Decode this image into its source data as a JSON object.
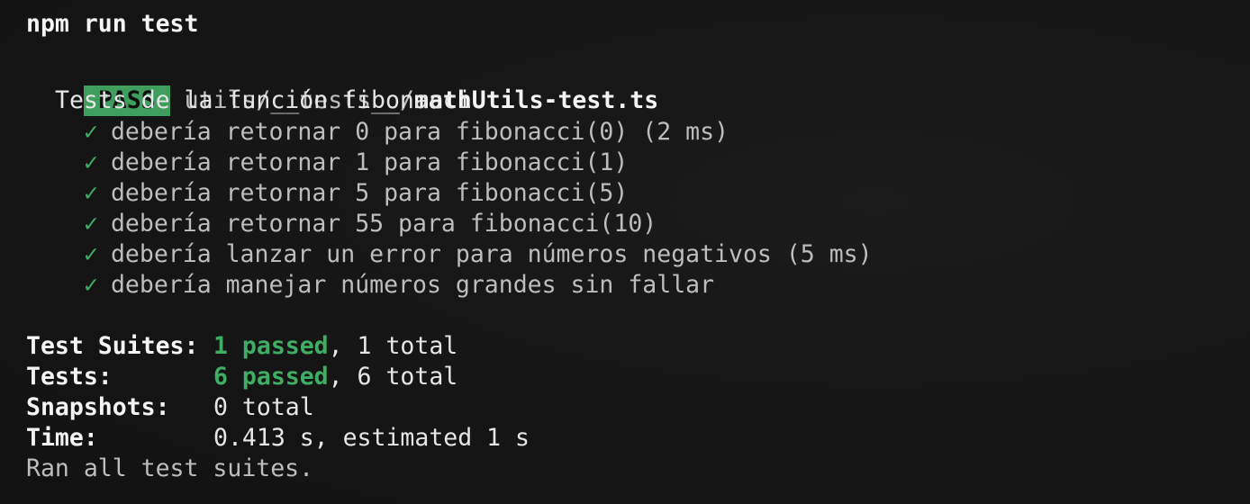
{
  "command": "npm run test",
  "result": {
    "badge": "PASS",
    "path_dir": "utils/__tests__/",
    "path_file": "mathUtils-test.ts"
  },
  "describe": "Tests de la función fibonacci",
  "check_glyph": "✓",
  "tests": [
    {
      "name": "debería retornar 0 para fibonacci(0)",
      "time": "(2 ms)"
    },
    {
      "name": "debería retornar 1 para fibonacci(1)",
      "time": ""
    },
    {
      "name": "debería retornar 5 para fibonacci(5)",
      "time": ""
    },
    {
      "name": "debería retornar 55 para fibonacci(10)",
      "time": ""
    },
    {
      "name": "debería lanzar un error para números negativos",
      "time": "(5 ms)"
    },
    {
      "name": "debería manejar números grandes sin fallar",
      "time": ""
    }
  ],
  "summary": {
    "suites_label": "Test Suites:",
    "suites_passed": "1 passed",
    "suites_total": ", 1 total",
    "tests_label": "Tests:",
    "tests_passed": "6 passed",
    "tests_total": ", 6 total",
    "snapshots_label": "Snapshots:",
    "snapshots_value": "0 total",
    "time_label": "Time:",
    "time_value": "0.413 s, estimated 1 s",
    "footer": "Ran all test suites."
  },
  "colors": {
    "background": "#161616",
    "pass_badge": "#3f9d5e",
    "passed_text": "#3fae63",
    "text": "#e6e6e6",
    "dim_text": "#bdbdbd"
  }
}
